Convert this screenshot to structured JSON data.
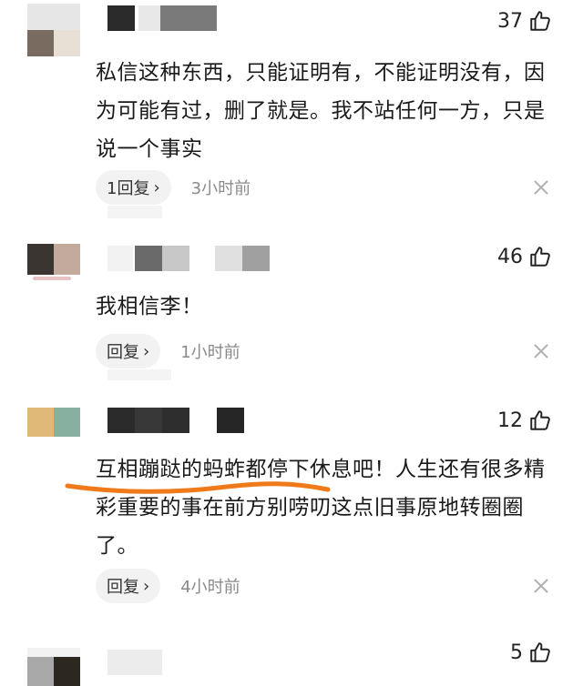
{
  "comments": [
    {
      "likes": "37",
      "text": "私信这种东西，只能证明有，不能证明没有，因为可能有过，删了就是。我不站任何一方，只是说一个事实",
      "reply_label": "1回复",
      "time": "3小时前"
    },
    {
      "likes": "46",
      "text": "我相信李！",
      "reply_label": "回复",
      "time": "1小时前"
    },
    {
      "likes": "12",
      "text": "互相蹦跶的蚂蚱都停下休息吧！人生还有很多精彩重要的事在前方别唠叨这点旧事原地转圈圈了。",
      "reply_label": "回复",
      "time": "4小时前"
    },
    {
      "likes": "5"
    }
  ],
  "icons": {
    "like": "thumbs-up-icon",
    "reply_arrow": "chevron-right-icon",
    "dismiss": "close-icon"
  },
  "colors": {
    "underline_annotation": "#f07a1a",
    "reply_bg": "#f2f2f2",
    "time_text": "#8a8a8a"
  }
}
